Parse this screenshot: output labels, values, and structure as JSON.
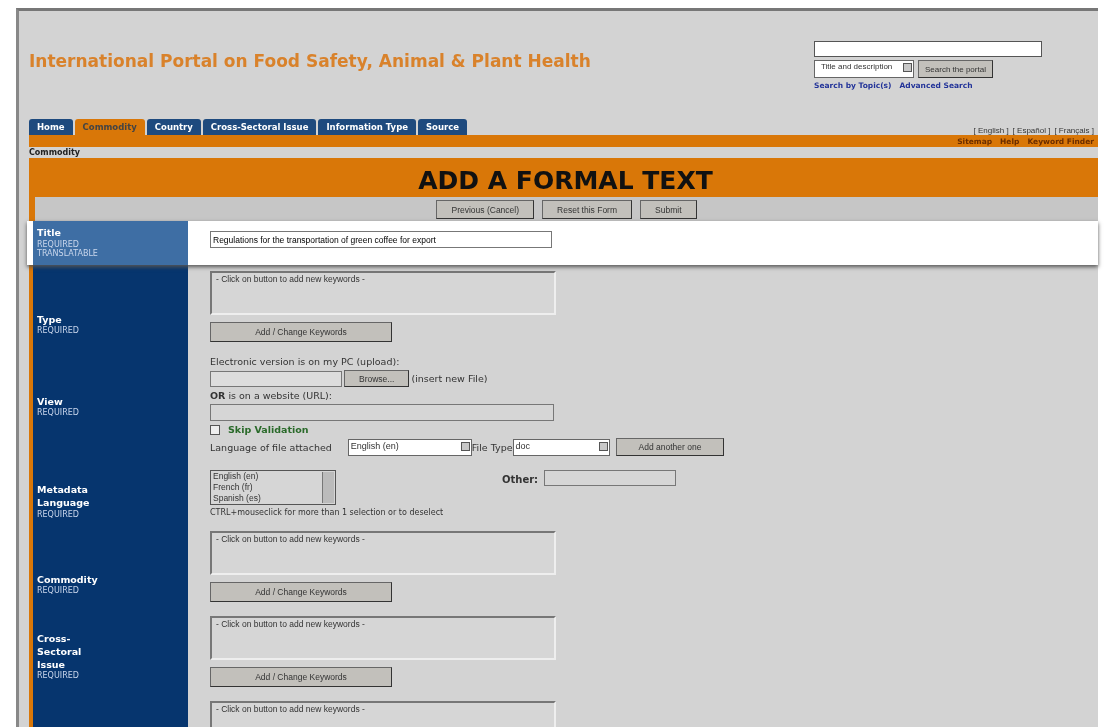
{
  "header": {
    "title": "International Portal on Food Safety, Animal & Plant Health"
  },
  "search": {
    "scope": "Title and description",
    "button": "Search the portal",
    "links": [
      "Search by Topic(s)",
      "Advanced Search"
    ]
  },
  "tabs": [
    {
      "label": "Home",
      "selected": false
    },
    {
      "label": "Commodity",
      "selected": true
    },
    {
      "label": "Country",
      "selected": false
    },
    {
      "label": "Cross-Sectoral Issue",
      "selected": false
    },
    {
      "label": "Information Type",
      "selected": false
    },
    {
      "label": "Source",
      "selected": false
    }
  ],
  "languages": [
    "[ English ]",
    "[ Español ]",
    "[ Français ]"
  ],
  "utility_links": [
    "Sitemap",
    "Help",
    "Keyword Finder"
  ],
  "breadcrumb": "Commodity",
  "heading": "ADD A FORMAL TEXT",
  "form_buttons": [
    "Previous (Cancel)",
    "Reset this Form",
    "Submit"
  ],
  "rows": [
    {
      "kind": "text",
      "label": "Title",
      "notes": [
        "REQUIRED",
        "TRANSLATABLE"
      ],
      "highlighted": true,
      "value": "Regulations for the transportation of green coffee for export"
    },
    {
      "kind": "keywords",
      "label": "Type",
      "notes": [
        "REQUIRED"
      ],
      "highlighted": false,
      "box_text": "- Click on button to add new keywords -",
      "button": "Add / Change Keywords"
    },
    {
      "kind": "upload",
      "label": "View",
      "notes": [
        "REQUIRED"
      ],
      "highlighted": false,
      "upload_label": "Electronic version is on my PC (upload):",
      "browse": "Browse...",
      "insert_note": "(insert new File)",
      "url_label": "**OR** is on a website (URL):",
      "skip": {
        "label": "Skip Validation",
        "checked": false
      },
      "lang_label": "Language of file attached",
      "lang_value": "English  (en)",
      "type_label": "File Type",
      "type_value": "doc",
      "add_button": "Add another one"
    },
    {
      "kind": "language",
      "label": "Metadata Language",
      "notes": [
        "REQUIRED"
      ],
      "highlighted": false,
      "options": [
        {
          "label": "English  (en)",
          "selected": false
        },
        {
          "label": "French  (fr)",
          "selected": false
        },
        {
          "label": "Spanish  (es)",
          "selected": false
        }
      ],
      "other_label": "Other:",
      "hint": "CTRL+mouseclick for more than 1 selection or to deselect"
    },
    {
      "kind": "keywords",
      "label": "Commodity",
      "notes": [
        "REQUIRED"
      ],
      "highlighted": false,
      "box_text": "- Click on button to add new keywords -",
      "button": "Add / Change Keywords"
    },
    {
      "kind": "keywords",
      "label": "Cross-Sectoral Issue",
      "notes": [
        "REQUIRED"
      ],
      "highlighted": false,
      "box_text": "- Click on button to add new keywords -",
      "button": "Add / Change Keywords"
    },
    {
      "kind": "keywords",
      "highlighted": false,
      "box_text": "- Click on button to add new keywords -"
    }
  ]
}
